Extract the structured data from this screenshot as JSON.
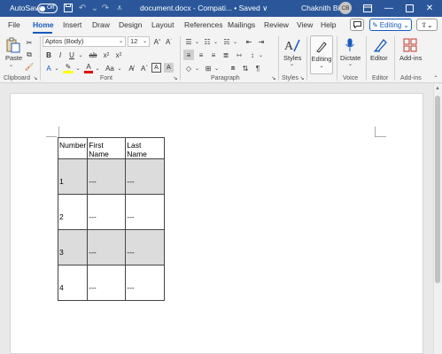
{
  "titlebar": {
    "autosave_label": "AutoSave",
    "autosave_state": "Off",
    "document_title": "document.docx  -  Compati...  • Saved  ∨",
    "user_name": "Chaknith Bin",
    "user_initials": "CB"
  },
  "tabs": [
    "File",
    "Home",
    "Insert",
    "Draw",
    "Design",
    "Layout",
    "References",
    "Mailings",
    "Review",
    "View",
    "Help"
  ],
  "active_tab": "Home",
  "editing_mode": "Editing",
  "ribbon": {
    "clipboard": {
      "paste_label": "Paste",
      "group_label": "Clipboard"
    },
    "font": {
      "font_name": "Aptos (Body)",
      "font_size": "12",
      "group_label": "Font"
    },
    "paragraph": {
      "group_label": "Paragraph"
    },
    "styles": {
      "label": "Styles",
      "group_label": "Styles"
    },
    "editing": {
      "label": "Editing"
    },
    "voice": {
      "dictate_label": "Dictate",
      "group_label": "Voice"
    },
    "editor": {
      "label": "Editor",
      "group_label": "Editor"
    },
    "addins": {
      "label": "Add-ins",
      "group_label": "Add-ins"
    }
  },
  "table": {
    "headers": [
      "Number",
      "First Name",
      "Last Name"
    ],
    "rows": [
      [
        "1",
        "---",
        "---"
      ],
      [
        "2",
        "---",
        "---"
      ],
      [
        "3",
        "---",
        "---"
      ],
      [
        "4",
        "---",
        "---"
      ]
    ]
  },
  "colors": {
    "titlebar": "#2b579a",
    "accent": "#185abd",
    "row_shade": "#dcdcdc"
  }
}
